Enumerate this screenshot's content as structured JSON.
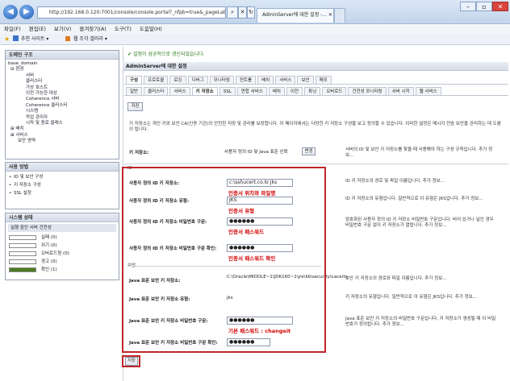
{
  "browser": {
    "url": "http://192.168.0.120:7001/console/console.portal?_nfpb=true&_pageLabel=...",
    "tab_title": "AdminServer에 대한 설정 -...",
    "menu": [
      "파일(F)",
      "편집(E)",
      "보기(V)",
      "즐겨찾기(A)",
      "도구(T)",
      "도움말(H)"
    ],
    "favorites": [
      "추천 사이트 ▾",
      "웹 조각 갤러리 ▾"
    ]
  },
  "domain_panel": {
    "title": "도메인 구조",
    "tree": [
      "base_domain",
      "⊟ 환경",
      "서버",
      "클러스터",
      "가상 호스트",
      "이전 가능한 대상",
      "Coherence 서버",
      "Coherence 클러스터",
      "시스템",
      "작업 관리자",
      "시작 및 종료 클래스",
      "⊞ 배치",
      "⊞ 서비스",
      "보안 영역"
    ]
  },
  "howto_panel": {
    "title": "사용 방법",
    "items": [
      "ID 및 보안 구성",
      "키 저장소 구성",
      "SSL 설정"
    ]
  },
  "status_panel": {
    "title": "시스템 상태",
    "subtitle": "실행 중인 서버 건전성",
    "rows": [
      {
        "label": "실패 (0)",
        "fill": 0
      },
      {
        "label": "위기 (0)",
        "fill": 0
      },
      {
        "label": "오버로드됨 (0)",
        "fill": 0
      },
      {
        "label": "경고 (0)",
        "fill": 0
      },
      {
        "label": "확인 (1)",
        "fill": 1
      }
    ],
    "ok_color": "#4d7a1f"
  },
  "content": {
    "success_msg": "설정이 성공적으로 갱신되었습니다.",
    "settings_title": "AdminServer에 대한 설정",
    "tabs1": [
      "구성",
      "프로토콜",
      "로깅",
      "디버그",
      "모니터링",
      "컨트롤",
      "배치",
      "서비스",
      "보안",
      "메모"
    ],
    "tabs2": [
      "일반",
      "클러스터",
      "서비스",
      "키 저장소",
      "SSL",
      "연합 서비스",
      "배치",
      "이전",
      "튜닝",
      "오버로드",
      "건전성 모니터링",
      "서버 시작",
      "웹 서비스"
    ],
    "save_label": "저장",
    "intro": "키 저장소는 개인 키와 보안 CA(인증 기관)의 안전한 저장 및 관리를 보장합니다. 이 페이지에서는 다양한 키 저장소 구성을 보고 정의할 수 있습니다. 이러한 설정은 메시지 전송 보안을 관리하는 데 도움이 됩니다.",
    "keystore_label": "키 저장소:",
    "keystore_value": "사용자 정의 ID 및 Java 표준 신뢰",
    "change_label": "변경",
    "keystore_desc": "서버의 ID 및 보안 키 저장소를 찾을 때 사용해야 하는 구성 규칙입니다. 추가 정보...",
    "id_section": "ID",
    "trust_section": "보안",
    "fields": [
      {
        "label": "사용자 정의 ID 키 저장소:",
        "value": "c:\\ssl\\ucert.co.kr.jks",
        "note": "인증서 위치와 파일명",
        "desc": "ID 키 저장소의 경로 및 파일 이름입니다. 추가 정보..."
      },
      {
        "label": "사용자 정의 ID 키 저장소 유형:",
        "value": "JKS",
        "note": "인증서 유형",
        "desc": "ID 키 저장소의 유형입니다. 일반적으로 이 유형은 JKS입니다. 추가 정보..."
      },
      {
        "label": "사용자 정의 ID 키 저장소 비밀번호 구문:",
        "value": "●●●●●●",
        "note": "인증서 패스워드",
        "desc": "암호화된 사용자 정의 ID 키 저장소 비밀번호 구문입니다. 비어 있거나 널인 경우 비밀번호 구문 없이 키 저장소가 열립니다. 추가 정보..."
      },
      {
        "label": "사용자 정의 ID 키 저장소 비밀번호 구문 확인:",
        "value": "●●●●●●",
        "note": "인증서 패스워드 확인",
        "desc": ""
      }
    ],
    "trust_fields": [
      {
        "label": "Java 표준 보안 키 저장소:",
        "value": "C:\\Oracle\\MIDDLE~1\\JDK160~1\\jre\\lib\\security\\cacerts",
        "desc": "보안 키 저장소의 경로와 파일 이름입니다. 추가 정보..."
      },
      {
        "label": "Java 표준 보안 키 저장소 유형:",
        "value": "jks",
        "desc": "키 저장소의 유형입니다. 일반적으로 이 유형은 JKS입니다. 추가 정보..."
      },
      {
        "label": "Java 표준 보안 키 저장소 비밀번호 구문:",
        "value": "●●●●●●",
        "note": "기본 패스워드 : changeit",
        "desc": "Java 표준 보안 키 저장소의 비밀번호 구문입니다. 키 저장소가 생성될 때 이 비밀번호가 정의됩니다. 추가 정보..."
      },
      {
        "label": "Java 표준 보안 키 저장소 비밀번호 구문 확인:",
        "value": "●●●●●●",
        "desc": ""
      }
    ],
    "highlight_color": "#c0262b"
  }
}
